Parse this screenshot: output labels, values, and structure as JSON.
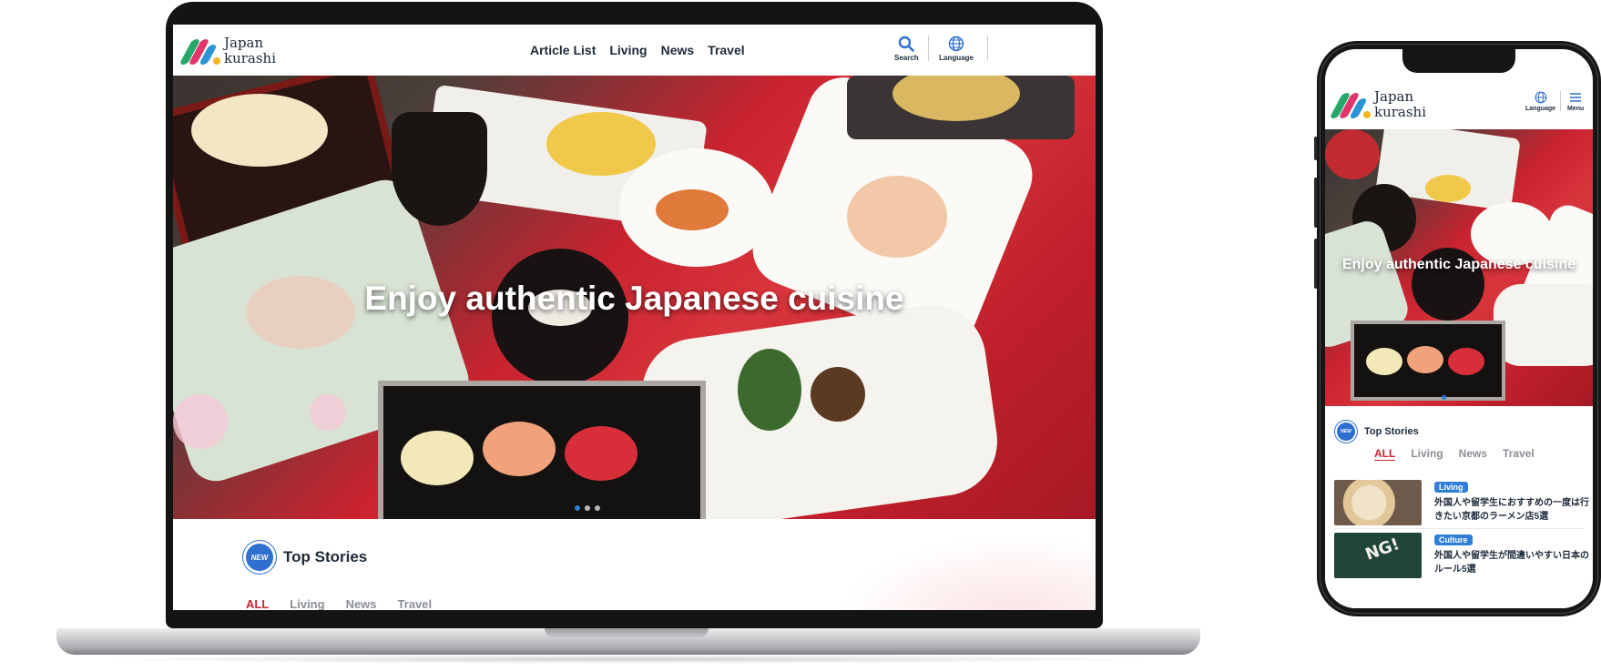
{
  "brand": {
    "name_line1": "Japan",
    "name_line2": "kurashi"
  },
  "desktop": {
    "nav": [
      "Article List",
      "Living",
      "News",
      "Travel"
    ],
    "search_label": "Search",
    "language_label": "Language",
    "hero_title": "Enjoy authentic Japanese cuisine",
    "section": {
      "badge": "NEW",
      "title": "Top Stories"
    },
    "tabs": [
      "ALL",
      "Living",
      "News",
      "Travel"
    ],
    "active_tab": "ALL"
  },
  "mobile": {
    "language_label": "Language",
    "menu_label": "Menu",
    "hero_title": "Enjoy authentic Japanese cuisine",
    "section": {
      "badge": "NEW",
      "title": "Top Stories"
    },
    "tabs": [
      "ALL",
      "Living",
      "News",
      "Travel"
    ],
    "articles": [
      {
        "category": "Living",
        "title": "外国人や留学生におすすめの一度は行きたい京都のラーメン店5選",
        "thumb_text": ""
      },
      {
        "category": "Culture",
        "title": "外国人や留学生が間違いやすい日本のルール5選",
        "thumb_text": "NG!"
      }
    ]
  },
  "colors": {
    "accent_red": "#c8232f",
    "accent_blue": "#2f7fd8",
    "text_dark": "#1c2a3a",
    "logo_green": "#27a86b",
    "logo_pink": "#e2356b",
    "logo_blue": "#2a93d5",
    "logo_yellow": "#f3b51f"
  },
  "icons": [
    "logo-icon",
    "search-icon",
    "globe-icon",
    "menu-icon"
  ]
}
